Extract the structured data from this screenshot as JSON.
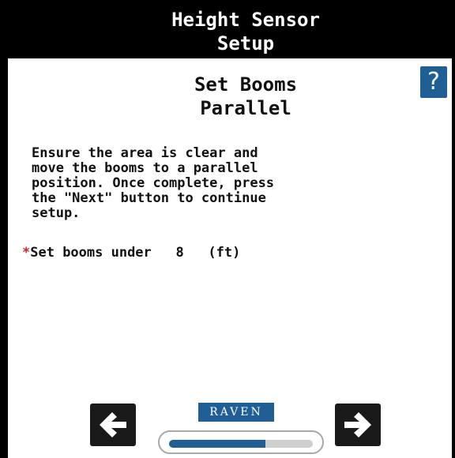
{
  "header": {
    "title_line1": "Height Sensor",
    "title_line2": "Setup"
  },
  "step": {
    "title_line1": "Set Booms",
    "title_line2": "Parallel"
  },
  "help": {
    "label": "?",
    "icon": "question-mark-icon"
  },
  "instructions": "Ensure the area is clear and\nmove the booms to a parallel\nposition. Once complete, press\nthe \"Next\" button to continue\nsetup.",
  "requirement": {
    "asterisk": "*",
    "text": "Set booms under   8   (ft)"
  },
  "navigation": {
    "back_icon": "arrow-left-icon",
    "next_icon": "arrow-right-icon"
  },
  "logo": {
    "text": "RAVEN"
  },
  "progress": {
    "fraction": 0.67
  },
  "colors": {
    "header_bg": "#000000",
    "accent_blue": "#1f5f96",
    "required_red": "#d0202a",
    "progress_track": "#cfcfcf"
  }
}
